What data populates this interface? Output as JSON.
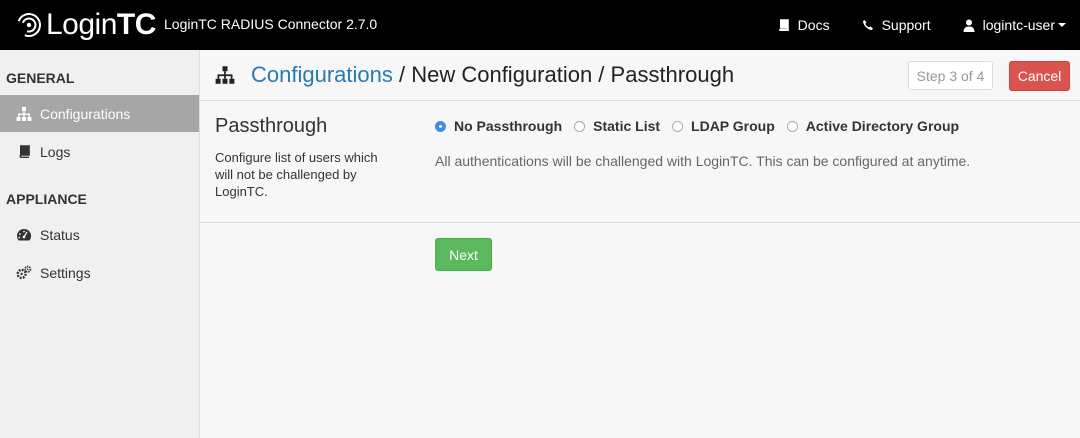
{
  "brand": {
    "logo_text_light": "Login",
    "logo_text_bold": "TC"
  },
  "app_title": "LoginTC RADIUS Connector 2.7.0",
  "nav": {
    "docs": "Docs",
    "support": "Support",
    "user": "logintc-user"
  },
  "sidebar": {
    "general_heading": "GENERAL",
    "appliance_heading": "APPLIANCE",
    "items": [
      {
        "label": "Configurations",
        "icon": "sitemap-icon",
        "active": true
      },
      {
        "label": "Logs",
        "icon": "book-icon",
        "active": false
      },
      {
        "label": "Status",
        "icon": "dashboard-icon",
        "active": false
      },
      {
        "label": "Settings",
        "icon": "gears-icon",
        "active": false
      }
    ]
  },
  "header": {
    "crumb_link": "Configurations",
    "crumb_rest": " / New Configuration / Passthrough",
    "step": "Step 3 of 4",
    "cancel": "Cancel"
  },
  "section": {
    "title": "Passthrough",
    "description": "Configure list of users which will not be challenged by LoginTC.",
    "options": [
      {
        "label": "No Passthrough",
        "checked": true
      },
      {
        "label": "Static List",
        "checked": false
      },
      {
        "label": "LDAP Group",
        "checked": false
      },
      {
        "label": "Active Directory Group",
        "checked": false
      }
    ],
    "help": "All authentications will be challenged with LoginTC. This can be configured at anytime."
  },
  "next_label": "Next",
  "colors": {
    "navbar": "#000000",
    "link": "#2a7ab0",
    "cancel": "#d9534f",
    "next": "#5cb85c",
    "radio_checked": "#3b8de8",
    "sidebar_active": "#a6a6a6"
  }
}
